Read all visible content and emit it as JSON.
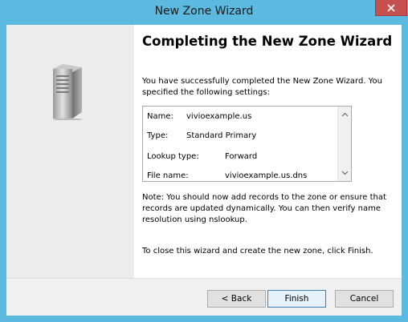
{
  "window": {
    "title": "New Zone Wizard"
  },
  "heading": "Completing the New Zone Wizard",
  "intro": "You have successfully completed the New Zone Wizard. You specified the following settings:",
  "settings": [
    {
      "label": "Name:",
      "value": "vivioexample.us"
    },
    {
      "label": "Type:",
      "value": "Standard Primary"
    },
    {
      "label": "Lookup type:",
      "value": "Forward"
    },
    {
      "label": "File name:",
      "value": "vivioexample.us.dns"
    }
  ],
  "note": "Note: You should now add records to the zone or ensure that records are updated dynamically. You can then verify name resolution using nslookup.",
  "closing": "To close this wizard and create the new zone, click Finish.",
  "buttons": {
    "back": "< Back",
    "finish": "Finish",
    "cancel": "Cancel"
  },
  "icons": {
    "close": "close-icon",
    "server": "server-icon",
    "scroll_up": "chevron-up-icon",
    "scroll_down": "chevron-down-icon"
  }
}
